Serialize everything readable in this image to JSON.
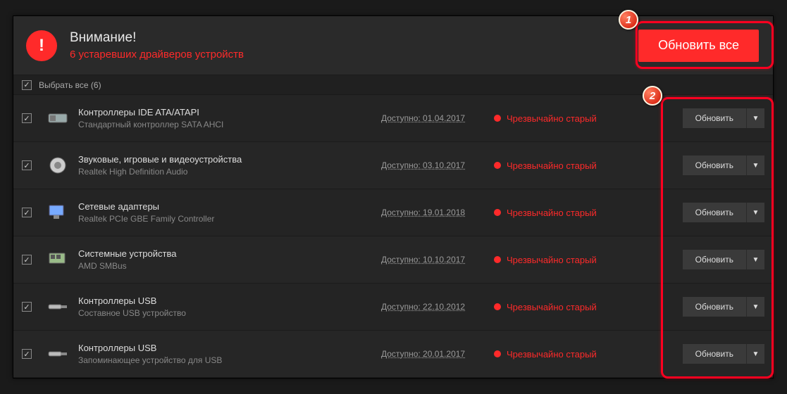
{
  "header": {
    "title": "Внимание!",
    "subtitle": "6 устаревших драйверов устройств",
    "update_all": "Обновить все"
  },
  "select_all": {
    "label": "Выбрать все (6)"
  },
  "row_labels": {
    "update": "Обновить"
  },
  "rows": [
    {
      "category": "Контроллеры IDE ATA/ATAPI",
      "name": "Стандартный контроллер SATA AHCI",
      "available": "Доступно: 01.04.2017",
      "status": "Чрезвычайно старый"
    },
    {
      "category": "Звуковые, игровые и видеоустройства",
      "name": "Realtek High Definition Audio",
      "available": "Доступно: 03.10.2017",
      "status": "Чрезвычайно старый"
    },
    {
      "category": "Сетевые адаптеры",
      "name": "Realtek PCIe GBE Family Controller",
      "available": "Доступно: 19.01.2018",
      "status": "Чрезвычайно старый"
    },
    {
      "category": "Системные устройства",
      "name": "AMD SMBus",
      "available": "Доступно: 10.10.2017",
      "status": "Чрезвычайно старый"
    },
    {
      "category": "Контроллеры USB",
      "name": "Составное USB устройство",
      "available": "Доступно: 22.10.2012",
      "status": "Чрезвычайно старый"
    },
    {
      "category": "Контроллеры USB",
      "name": "Запоминающее устройство для USB",
      "available": "Доступно: 20.01.2017",
      "status": "Чрезвычайно старый"
    }
  ],
  "callouts": {
    "one": "1",
    "two": "2"
  }
}
